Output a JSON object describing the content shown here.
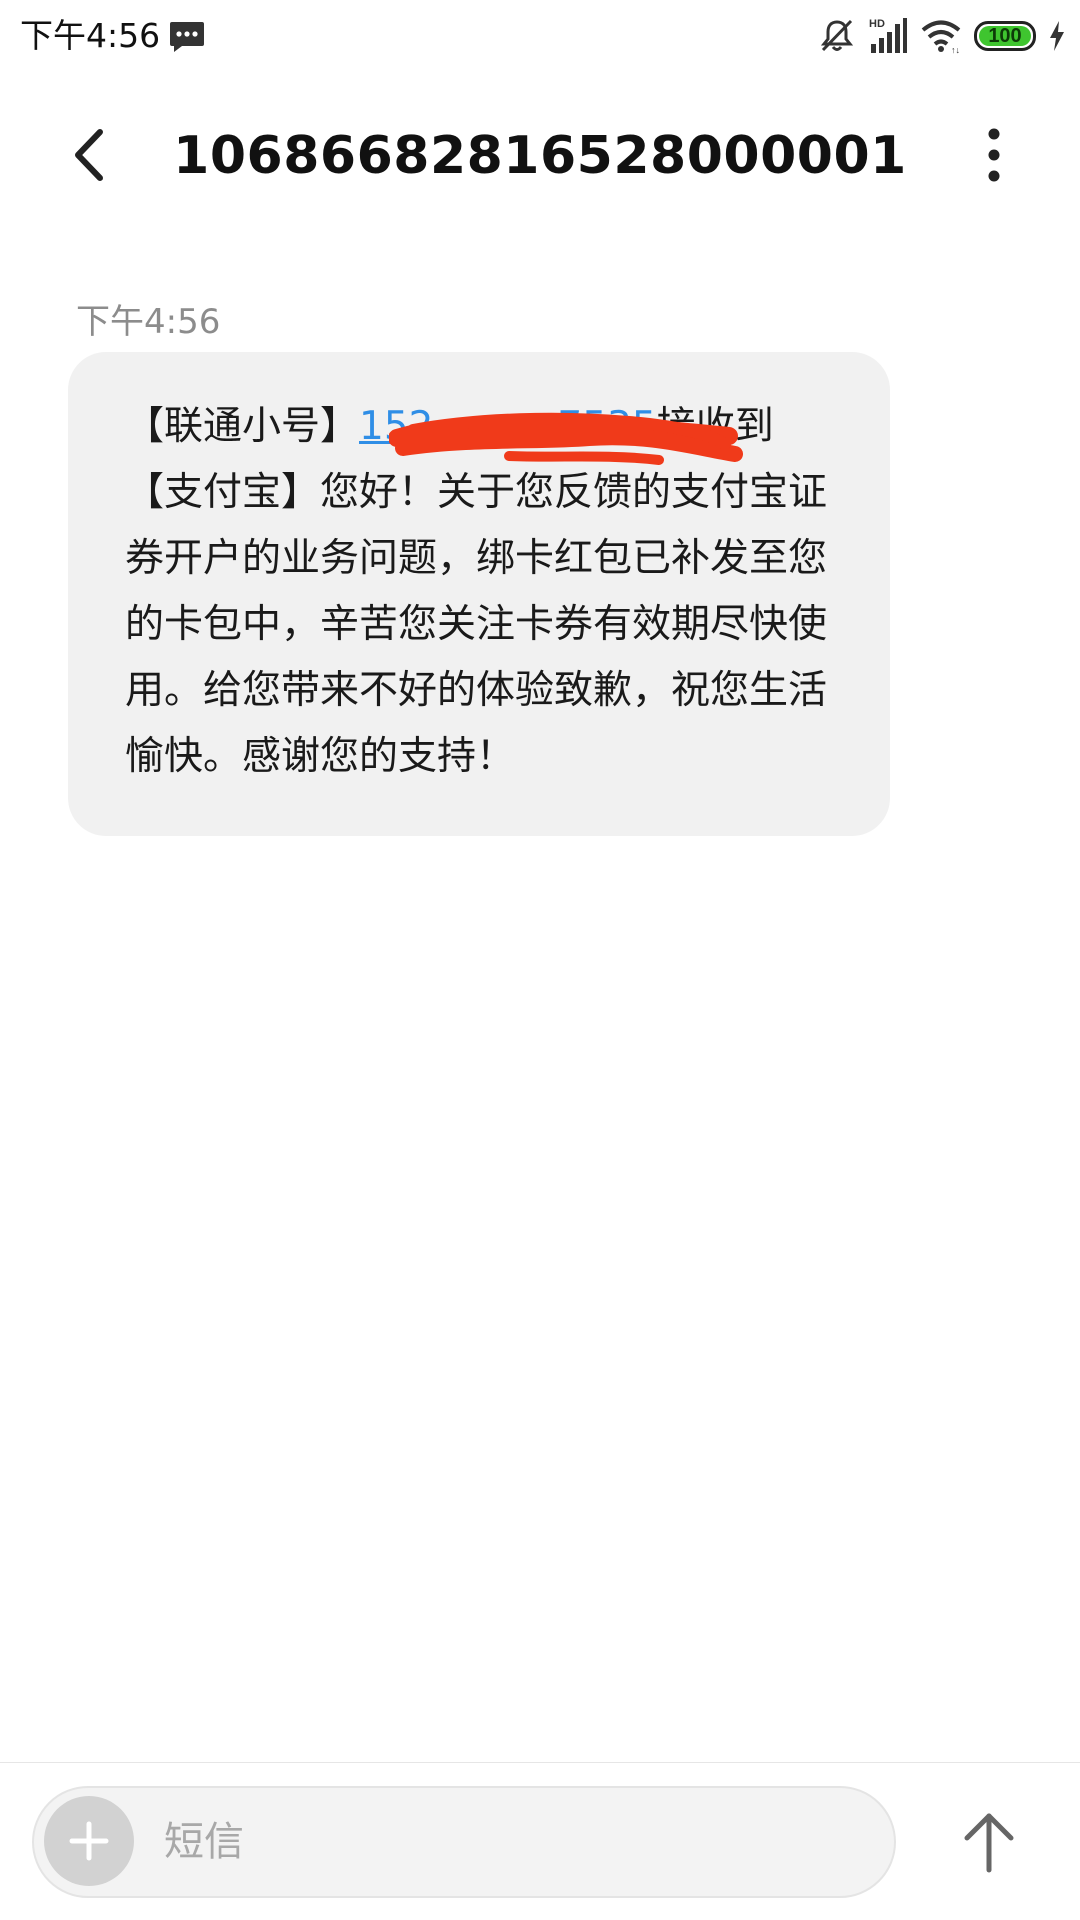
{
  "status_bar": {
    "time": "下午4:56",
    "battery_level": "100",
    "battery_fraction": 1.0,
    "icons": [
      "message-icon",
      "bell-muted-icon",
      "hd-signal-icon",
      "wifi-icon",
      "battery-icon",
      "charging-icon"
    ]
  },
  "header": {
    "title": "10686682816528000001",
    "icons": [
      "back-arrow-icon",
      "more-vertical-icon"
    ]
  },
  "message": {
    "time": "下午4:56",
    "text_prefix": "【联通小号】",
    "link_visible": "152··········7535",
    "text_main": "接收到【支付宝】您好！关于您反馈的支付宝证券开户的业务问题，绑卡红包已补发至您的卡包中，辛苦您关注卡券有效期尽快使用。给您带来不好的体验致歉，祝您生活愉快。感谢您的支持！"
  },
  "composer": {
    "placeholder": "短信",
    "value": "",
    "icons": [
      "add-icon",
      "send-arrow-icon"
    ]
  },
  "colors": {
    "bubble_bg": "#f1f1f1",
    "link": "#2f8ee6",
    "redaction": "#f03a1a",
    "battery": "#3fc52f",
    "muted_text": "#8c8c8c"
  }
}
